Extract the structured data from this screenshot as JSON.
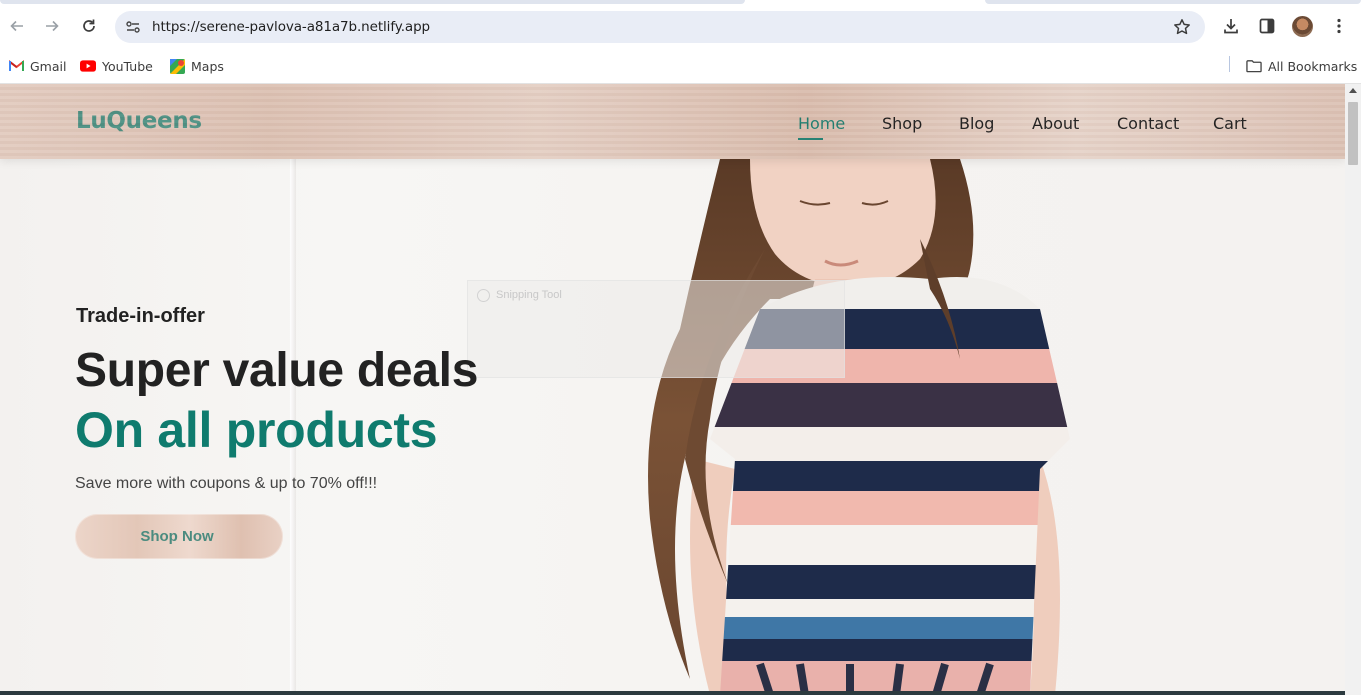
{
  "browser": {
    "url": "https://serene-pavlova-a81a7b.netlify.app",
    "bookmarks": [
      {
        "label": "Gmail",
        "icon": "gmail-icon"
      },
      {
        "label": "YouTube",
        "icon": "youtube-icon"
      },
      {
        "label": "Maps",
        "icon": "maps-icon"
      }
    ],
    "all_bookmarks_label": "All Bookmarks"
  },
  "site": {
    "logo": "LuQueens",
    "nav": [
      {
        "label": "Home",
        "active": true
      },
      {
        "label": "Shop"
      },
      {
        "label": "Blog"
      },
      {
        "label": "About"
      },
      {
        "label": "Contact"
      },
      {
        "label": "Cart"
      }
    ],
    "colors": {
      "accent": "#0f7b6e",
      "logo": "#4a8f82",
      "header_bg": "#dfc5b8"
    }
  },
  "hero": {
    "eyebrow": "Trade-in-offer",
    "title": "Super value deals",
    "accent_title": "On all products",
    "subtitle": "Save more with coupons & up to 70% off!!!",
    "cta_label": "Shop Now"
  },
  "overlay": {
    "snipping_tool_label": "Snipping Tool"
  }
}
